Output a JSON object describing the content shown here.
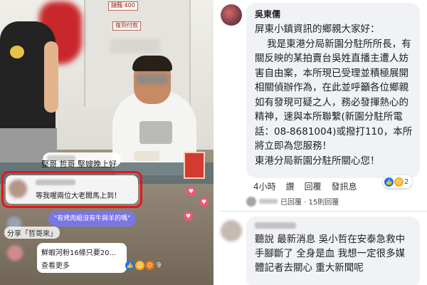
{
  "stream": {
    "signs": {
      "price": "鏈麵 400",
      "pay": "復到付款"
    },
    "chat_top": "堅哥 哲哥 堅嫂晚上好",
    "chat_highlight": "等我喔兩位大老闆馬上到！",
    "suggestion_pill": "\"有烤肉組沒有牛與羊的嗎\"",
    "share_line": "分享「哲哥來」",
    "bottom_card": {
      "text": "鮮蝦河粉16條只要20...",
      "more": "查看更多"
    },
    "reactions": {
      "count": "9"
    }
  },
  "comment": {
    "author": "吳東儒",
    "body": "屏東小鎮資訊的鄉親大家好：\n    我是東港分局新園分駐所所長，有關反映的某拍賣台吳姓直播主遭人妨害自由案，本所現已受理並積極展開相關偵辦作為，在此並呼籲各位鄉親如有發現可疑之人，務必發揮熱心的精神，速與本所聯繫(新園分駐所電話：08-8681004)或撥打110，本所將立即為您服務！\n東港分局新園分駐所關心您！",
    "actions": {
      "time": "4小時",
      "like": "讚",
      "reply": "回覆",
      "send": "發訊息"
    },
    "reaction_count": "2",
    "reply_summary": "已回覆 · 15則回覆"
  },
  "comment2": {
    "body": "聽說 最新消息 吳小哲在安泰急救中 手腳斷了 全身是血 我想一定很多媒體記者去關心 重大新聞呢"
  },
  "colors": {
    "highlight": "#e4161c",
    "pill": "#7b76e6",
    "bubble": "#f0f2f5"
  }
}
